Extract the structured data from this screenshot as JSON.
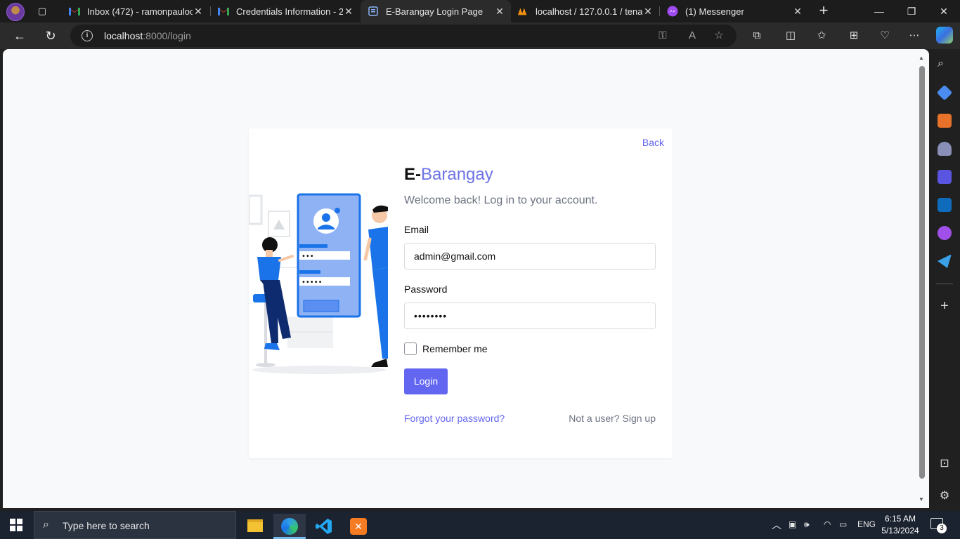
{
  "browser": {
    "tabs": [
      {
        "title": "Inbox (472) - ramonpauloca",
        "favicon": "gmail-icon",
        "active": false
      },
      {
        "title": "Credentials Information - 21",
        "favicon": "gmail-icon",
        "active": false
      },
      {
        "title": "E-Barangay Login Page",
        "favicon": "page-icon",
        "active": true
      },
      {
        "title": "localhost / 127.0.0.1 / tenar",
        "favicon": "phpmyadmin-icon",
        "active": false
      },
      {
        "title": "(1) Messenger",
        "favicon": "messenger-icon",
        "active": false
      }
    ],
    "url_host": "localhost",
    "url_path": ":8000/login"
  },
  "page": {
    "back_label": "Back",
    "brand_prefix": "E-",
    "brand_accent": "Barangay",
    "welcome": "Welcome back! Log in to your account.",
    "email_label": "Email",
    "email_value": "admin@gmail.com",
    "password_label": "Password",
    "password_value": "••••••••",
    "remember_label": "Remember me",
    "login_label": "Login",
    "forgot_label": "Forgot your password?",
    "signup_label": "Not a user? Sign up"
  },
  "taskbar": {
    "search_placeholder": "Type here to search",
    "language": "ENG",
    "time": "6:15 AM",
    "date": "5/13/2024",
    "notification_count": "3"
  },
  "colors": {
    "accent": "#6366f1",
    "brand_accent": "#6c72e3",
    "illustration_blue": "#1a73e8"
  }
}
